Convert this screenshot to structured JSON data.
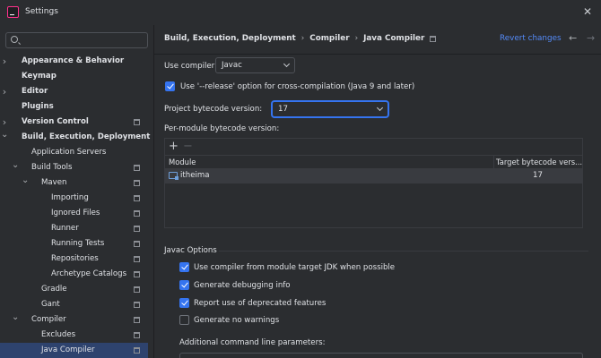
{
  "window": {
    "title": "Settings"
  },
  "search": {
    "placeholder": ""
  },
  "sidebar": {
    "items": [
      {
        "label": "Appearance & Behavior",
        "bold": true,
        "level": 0,
        "chevron": "right"
      },
      {
        "label": "Keymap",
        "bold": true,
        "level": 0,
        "chevron": ""
      },
      {
        "label": "Editor",
        "bold": true,
        "level": 0,
        "chevron": "right"
      },
      {
        "label": "Plugins",
        "bold": true,
        "level": 0,
        "chevron": ""
      },
      {
        "label": "Version Control",
        "bold": true,
        "level": 0,
        "chevron": "right",
        "proj": true
      },
      {
        "label": "Build, Execution, Deployment",
        "bold": true,
        "level": 0,
        "chevron": "down"
      },
      {
        "label": "Application Servers",
        "bold": false,
        "level": 1,
        "chevron": ""
      },
      {
        "label": "Build Tools",
        "bold": false,
        "level": 1,
        "chevron": "down",
        "proj": true
      },
      {
        "label": "Maven",
        "bold": false,
        "level": 2,
        "chevron": "down",
        "proj": true
      },
      {
        "label": "Importing",
        "bold": false,
        "level": 3,
        "chevron": "",
        "proj": true
      },
      {
        "label": "Ignored Files",
        "bold": false,
        "level": 3,
        "chevron": "",
        "proj": true
      },
      {
        "label": "Runner",
        "bold": false,
        "level": 3,
        "chevron": "",
        "proj": true
      },
      {
        "label": "Running Tests",
        "bold": false,
        "level": 3,
        "chevron": "",
        "proj": true
      },
      {
        "label": "Repositories",
        "bold": false,
        "level": 3,
        "chevron": "",
        "proj": true
      },
      {
        "label": "Archetype Catalogs",
        "bold": false,
        "level": 3,
        "chevron": "",
        "proj": true
      },
      {
        "label": "Gradle",
        "bold": false,
        "level": 2,
        "chevron": "",
        "proj": true
      },
      {
        "label": "Gant",
        "bold": false,
        "level": 2,
        "chevron": "",
        "proj": true
      },
      {
        "label": "Compiler",
        "bold": false,
        "level": 1,
        "chevron": "down",
        "proj": true
      },
      {
        "label": "Excludes",
        "bold": false,
        "level": 2,
        "chevron": "",
        "proj": true
      },
      {
        "label": "Java Compiler",
        "bold": false,
        "level": 2,
        "chevron": "",
        "proj": true,
        "selected": true
      }
    ]
  },
  "header": {
    "crumbs": [
      "Build, Execution, Deployment",
      "Compiler",
      "Java Compiler"
    ],
    "separator": "›",
    "revert": "Revert changes",
    "back": "←",
    "forward": "→"
  },
  "form": {
    "use_compiler_label": "Use compiler:",
    "use_compiler_value": "Javac",
    "release_option_label": "Use '--release' option for cross-compilation (Java 9 and later)",
    "release_option_checked": true,
    "bytecode_label": "Project bytecode version:",
    "bytecode_value": "17",
    "per_module_label": "Per-module bytecode version:"
  },
  "table": {
    "add": "+",
    "remove": "−",
    "columns": [
      "Module",
      "Target bytecode vers..."
    ],
    "rows": [
      {
        "module": "itheima",
        "target": "17"
      }
    ]
  },
  "javac": {
    "section_title": "Javac Options",
    "options": [
      {
        "label": "Use compiler from module target JDK when possible",
        "checked": true
      },
      {
        "label": "Generate debugging info",
        "checked": true
      },
      {
        "label": "Report use of deprecated features",
        "checked": true
      },
      {
        "label": "Generate no warnings",
        "checked": false
      }
    ],
    "additional_params_label": "Additional command line parameters:"
  },
  "colors": {
    "accent": "#3574f0",
    "link": "#548af7",
    "selection": "#2e436e",
    "background": "#2b2d30"
  },
  "icons": [
    "app-logo-icon",
    "close-icon",
    "search-icon",
    "chevron-right-icon",
    "chevron-down-icon",
    "project-scope-icon",
    "back-arrow-icon",
    "forward-arrow-icon",
    "add-icon",
    "remove-icon",
    "module-folder-icon",
    "checkbox-checked-icon"
  ]
}
